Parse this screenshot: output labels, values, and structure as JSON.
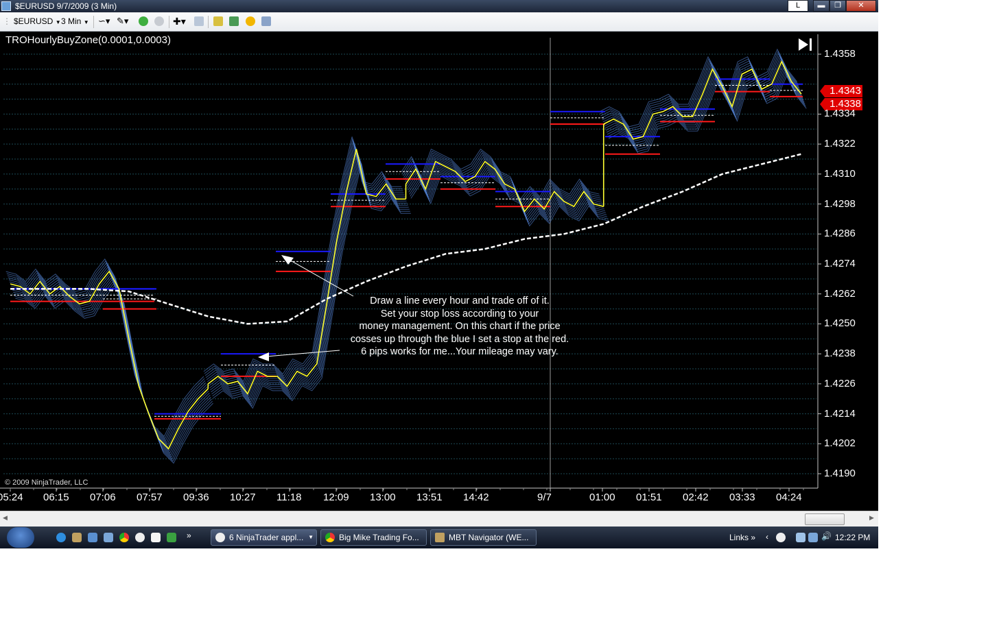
{
  "window": {
    "title": "$EURUSD  9/7/2009 (3 Min)",
    "buttons": {
      "extra": "L"
    }
  },
  "toolbar": {
    "instrument": "$EURUSD",
    "interval": "3 Min"
  },
  "chart": {
    "indicator_name": "TROHourlyBuyZone(0.0001,0.0003)",
    "copyright": "© 2009 NinjaTrader, LLC",
    "annotation": [
      "Draw a line every hour and trade off of it.",
      "Set your stop loss according to your",
      "money management.  On this chart if the price",
      "cosses up through the blue I set a stop at the red.",
      "6 pips works for me...Your mileage may vary."
    ],
    "price_labels": [
      "1.4343",
      "1.4338"
    ],
    "colors": {
      "background": "#000000",
      "price_line": "#ffff33",
      "zone_fill": "#5b8ee8",
      "blue_line": "#1a1aff",
      "red_line": "#ff1a1a",
      "ma_line": "#ffffff",
      "label_red": "#e00000"
    }
  },
  "chart_data": {
    "type": "line",
    "title": "TROHourlyBuyZone(0.0001,0.0003)",
    "xlabel": "",
    "ylabel": "",
    "ylim": [
      1.4185,
      1.4365
    ],
    "grid": true,
    "y_ticks": [
      "1.4358",
      "1.4334",
      "1.4322",
      "1.4310",
      "1.4298",
      "1.4286",
      "1.4274",
      "1.4262",
      "1.4250",
      "1.4238",
      "1.4226",
      "1.4214",
      "1.4202",
      "1.4190"
    ],
    "x_ticks": [
      "05:24",
      "06:15",
      "07:06",
      "07:57",
      "09:36",
      "10:27",
      "11:18",
      "12:09",
      "13:00",
      "13:51",
      "14:42",
      "9/7",
      "01:00",
      "01:51",
      "02:42",
      "03:33",
      "04:24"
    ],
    "series": [
      {
        "x": [
          0,
          5,
          10,
          15,
          20,
          25,
          30,
          35,
          40,
          45,
          50,
          55,
          60,
          65,
          70,
          75,
          80,
          85,
          90,
          95,
          100
        ],
        "values": [
          1.4266,
          1.4265,
          1.4262,
          1.4267,
          1.4262,
          1.4265,
          1.4261,
          1.4258,
          1.4259,
          1.4266,
          1.4271,
          1.4264,
          1.4244,
          1.4225,
          1.4214,
          1.4204,
          1.42,
          1.4208,
          1.4215,
          1.422,
          1.4224
        ]
      },
      {
        "x": [
          100,
          105,
          110,
          115,
          120,
          125,
          130,
          135,
          140,
          145,
          150,
          155,
          160,
          165,
          170,
          175,
          180,
          185,
          190,
          195,
          200
        ],
        "values": [
          1.4226,
          1.4229,
          1.4226,
          1.4227,
          1.4222,
          1.4231,
          1.4229,
          1.4229,
          1.4225,
          1.4231,
          1.4229,
          1.4234,
          1.4258,
          1.4283,
          1.4303,
          1.432,
          1.4302,
          1.4301,
          1.4306,
          1.43,
          1.43
        ]
      },
      {
        "x": [
          200,
          205,
          210,
          215,
          220,
          225,
          230,
          235,
          240,
          245,
          250,
          255,
          260,
          265,
          270,
          275,
          280,
          285,
          290,
          295,
          300
        ],
        "values": [
          1.4306,
          1.4312,
          1.4304,
          1.4315,
          1.4313,
          1.4311,
          1.4307,
          1.4309,
          1.4315,
          1.4312,
          1.4306,
          1.4304,
          1.4295,
          1.43,
          1.4296,
          1.4303,
          1.4299,
          1.4297,
          1.4303,
          1.4298,
          1.4297
        ]
      },
      {
        "x": [
          300,
          305,
          310,
          315,
          320,
          325,
          330,
          335,
          340,
          345,
          350,
          355,
          360,
          365,
          370,
          375,
          380,
          385,
          390,
          395,
          400
        ],
        "values": [
          1.433,
          1.4332,
          1.433,
          1.4324,
          1.4325,
          1.4334,
          1.4335,
          1.4337,
          1.4333,
          1.4333,
          1.4342,
          1.4352,
          1.4345,
          1.4337,
          1.435,
          1.4352,
          1.4344,
          1.4346,
          1.4355,
          1.4347,
          1.4342
        ]
      },
      {
        "x": [
          0,
          20,
          40,
          60,
          80,
          100,
          120,
          140,
          160,
          180,
          200,
          220,
          240,
          260,
          280,
          300,
          320,
          340,
          360,
          380,
          400
        ],
        "values": [
          1.4264,
          1.4264,
          1.4264,
          1.4263,
          1.4258,
          1.4253,
          1.425,
          1.4251,
          1.426,
          1.4267,
          1.4273,
          1.4278,
          1.428,
          1.4284,
          1.4286,
          1.429,
          1.4297,
          1.4303,
          1.431,
          1.4314,
          1.4318
        ]
      }
    ]
  },
  "taskbar": {
    "tasks": [
      "6 NinjaTrader appl...",
      "Big Mike Trading Fo...",
      "MBT Navigator (WE..."
    ],
    "links": "Links",
    "clock": "12:22 PM"
  }
}
